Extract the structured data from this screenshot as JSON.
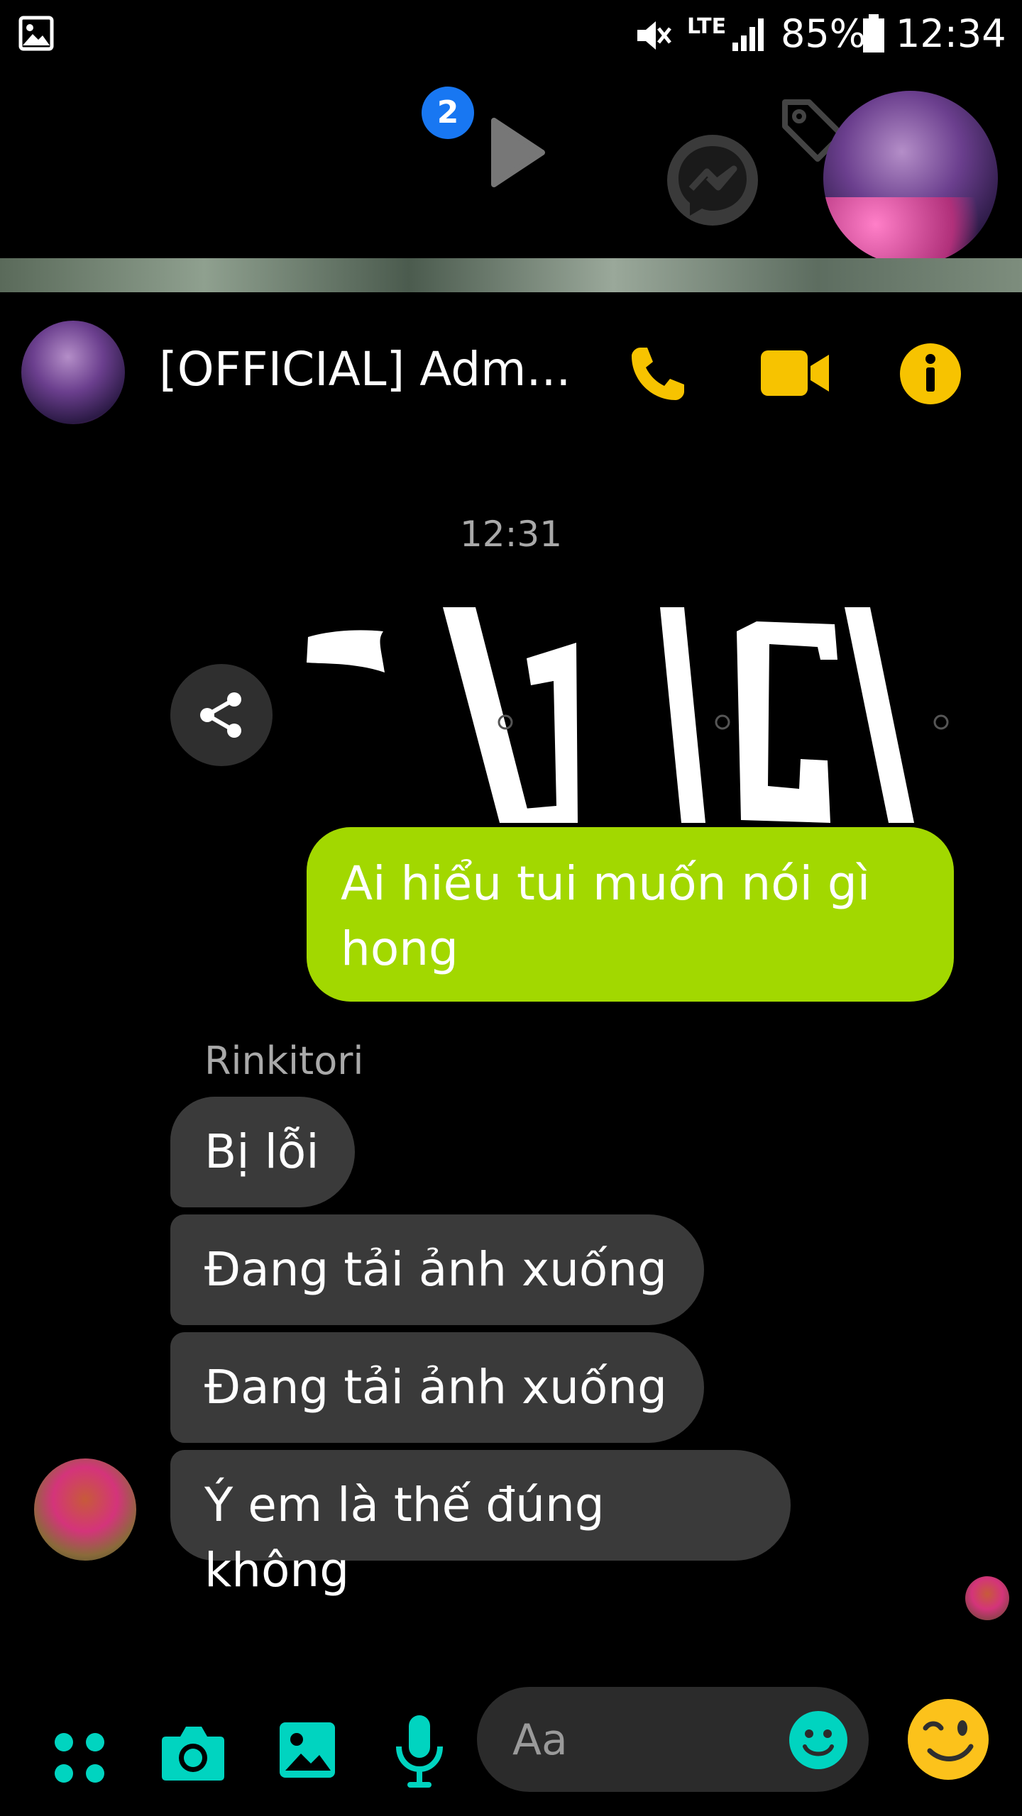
{
  "status_bar": {
    "battery": "85%",
    "time": "12:34",
    "network": "LTE"
  },
  "chat_heads": {
    "badge_count": "2"
  },
  "header": {
    "title": "[OFFICIAL] Adm...",
    "call_icon": "phone-icon",
    "video_icon": "video-camera-icon",
    "info_icon": "info-icon"
  },
  "conversation": {
    "timestamp": "12:31",
    "outgoing": [
      {
        "lines": [
          "Ai hiểu tui muốn nói gì",
          "hong"
        ]
      }
    ],
    "sender_name": "Rinkitori",
    "incoming": [
      {
        "text": "Bị lỗi"
      },
      {
        "text": "Đang tải ảnh xuống"
      },
      {
        "text": "Đang tải ảnh xuống"
      },
      {
        "text": "Ý em là thế đúng không"
      }
    ]
  },
  "composer": {
    "placeholder": "Aa",
    "icons": [
      "menu-dots-icon",
      "camera-icon",
      "gallery-icon",
      "microphone-icon",
      "emoji-icon",
      "wink-emoji-icon"
    ]
  },
  "colors": {
    "accent": "#00d4c0",
    "header_icons": "#f7c300",
    "outgoing_bubble": "#a2d800",
    "incoming_bubble": "#3a3a3a",
    "badge": "#1877f2"
  }
}
